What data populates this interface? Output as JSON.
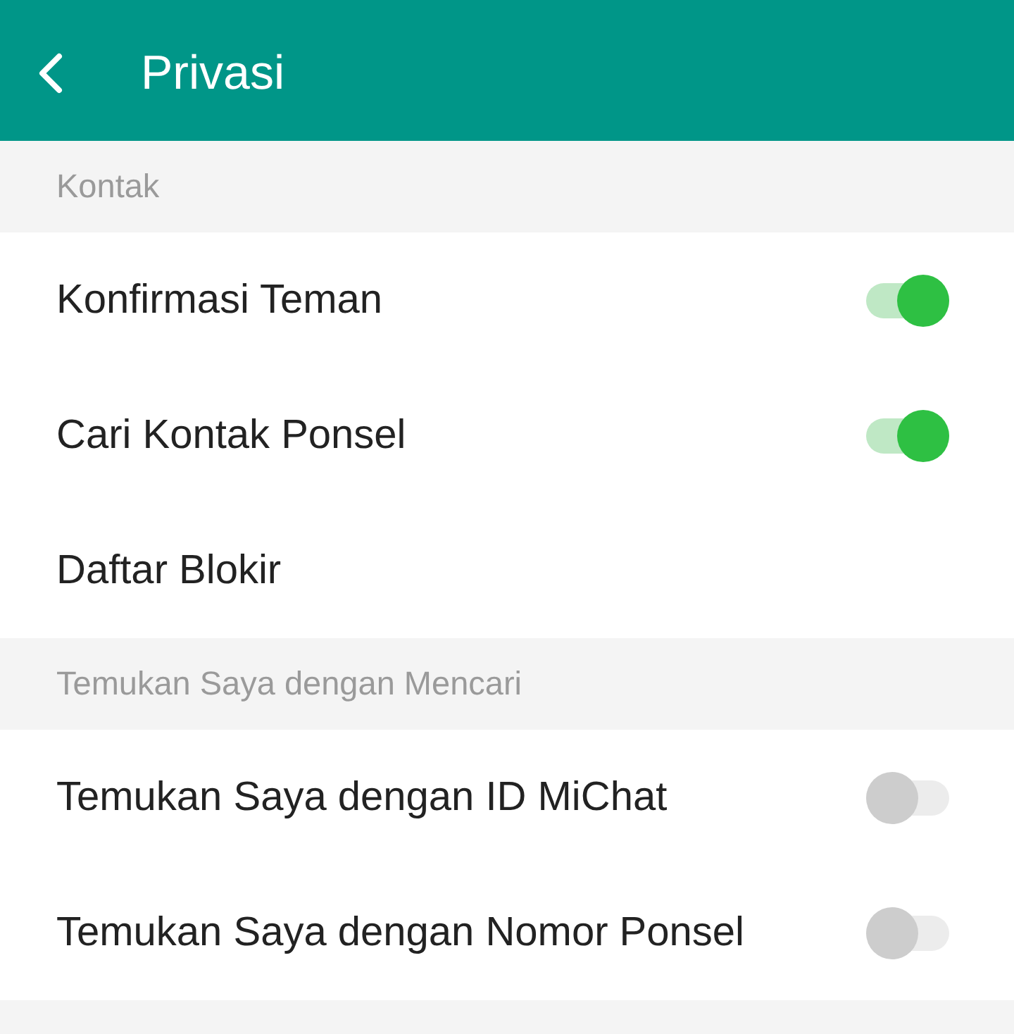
{
  "header": {
    "title": "Privasi"
  },
  "sections": [
    {
      "title": "Kontak",
      "rows": [
        {
          "label": "Konfirmasi Teman",
          "kind": "toggle",
          "on": true
        },
        {
          "label": "Cari Kontak Ponsel",
          "kind": "toggle",
          "on": true
        },
        {
          "label": "Daftar Blokir",
          "kind": "link"
        }
      ]
    },
    {
      "title": "Temukan Saya dengan Mencari",
      "rows": [
        {
          "label": "Temukan Saya dengan ID MiChat",
          "kind": "toggle",
          "on": false
        },
        {
          "label": "Temukan Saya dengan Nomor Ponsel",
          "kind": "toggle",
          "on": false
        }
      ]
    }
  ]
}
